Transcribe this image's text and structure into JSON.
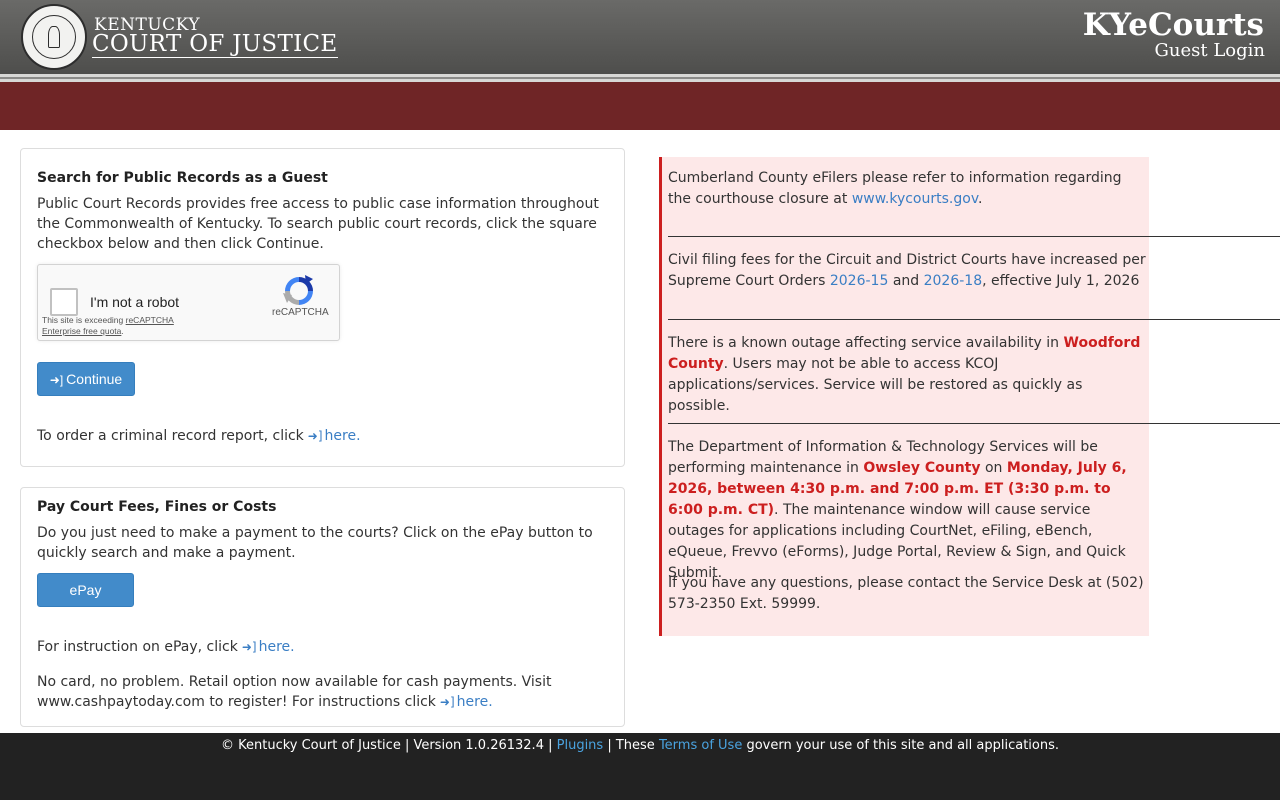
{
  "header": {
    "org_top": "KENTUCKY",
    "org_main": "COURT OF JUSTICE",
    "brand": "KYeCourts",
    "subtitle": "Guest Login",
    "seal_text": "COMMONWEALTH OF KENTUCKY · COURT OF JUSTICE"
  },
  "guest_search": {
    "title": "Search for Public Records as a Guest",
    "description": "Public Court Records provides free access to public case information throughout the Commonwealth of Kentucky. To search public court records, click the square checkbox below and then click Continue.",
    "recaptcha": {
      "label": "I'm not a robot",
      "brand": "reCAPTCHA",
      "note_prefix": "This site is exceeding ",
      "note_link": "reCAPTCHA Enterprise free quota",
      "note_suffix": ".",
      "checked": false
    },
    "continue_label": "Continue",
    "criminal_text": "To order a criminal record report, click",
    "criminal_link": "here."
  },
  "pay": {
    "title": "Pay Court Fees, Fines or Costs",
    "description": "Do you just need to make a payment to the courts? Click on the ePay button to quickly search and make a payment.",
    "epay_label": "ePay",
    "instruction_text": "For instruction on ePay, click",
    "instruction_link": "here.",
    "cash_text": "No card, no problem. Retail option now available for cash payments. Visit www.cashpaytoday.com to register! For instructions click",
    "cash_link": "here."
  },
  "notices": {
    "n1_text": "Cumberland County eFilers please refer to information regarding the courthouse closure at",
    "n1_link": "www.kycourts.gov",
    "n1_end": ".",
    "n2_a": "Civil filing fees for the Circuit and District Courts have increased per Supreme Court Orders",
    "n2_link1": "2026-15",
    "n2_b": "and",
    "n2_link2": "2026-18",
    "n2_c": ", effective July 1, 2026",
    "n3_a": "There is a known outage affecting service availability in",
    "n3_bold": "Woodford County",
    "n3_b": ". Users may not be able to access KCOJ applications/services. Service will be restored as quickly as possible.",
    "n4_a": "The Department of Information & Technology Services will be performing maintenance in",
    "n4_bold1": "Owsley County",
    "n4_b": "on",
    "n4_bold2": "Monday, July 6, 2026, between 4:30 p.m. and 7:00 p.m. ET (3:30 p.m. to 6:00 p.m. CT)",
    "n4_c": ". The maintenance window will cause service outages for applications including CourtNet, eFiling, eBench, eQueue, Frevvo (eForms), Judge Portal, Review & Sign, and Quick Submit.",
    "n5": "If you have any questions, please contact the Service Desk at (502) 573-2350 Ext. 59999."
  },
  "footer": {
    "copyright": "© Kentucky Court of Justice | Version 1.0.26132.4 |",
    "plugins": "Plugins",
    "sep": "| These",
    "terms": "Terms of Use",
    "end": "govern your use of this site and all applications."
  },
  "colors": {
    "header_gray": "#5c5c5a",
    "band_red": "#6f2526",
    "button_blue": "#428bca",
    "link_blue": "#3a7ec4",
    "notice_bg": "#fde8e8",
    "notice_red": "#cc1f1f",
    "footer_bg": "#222222"
  }
}
